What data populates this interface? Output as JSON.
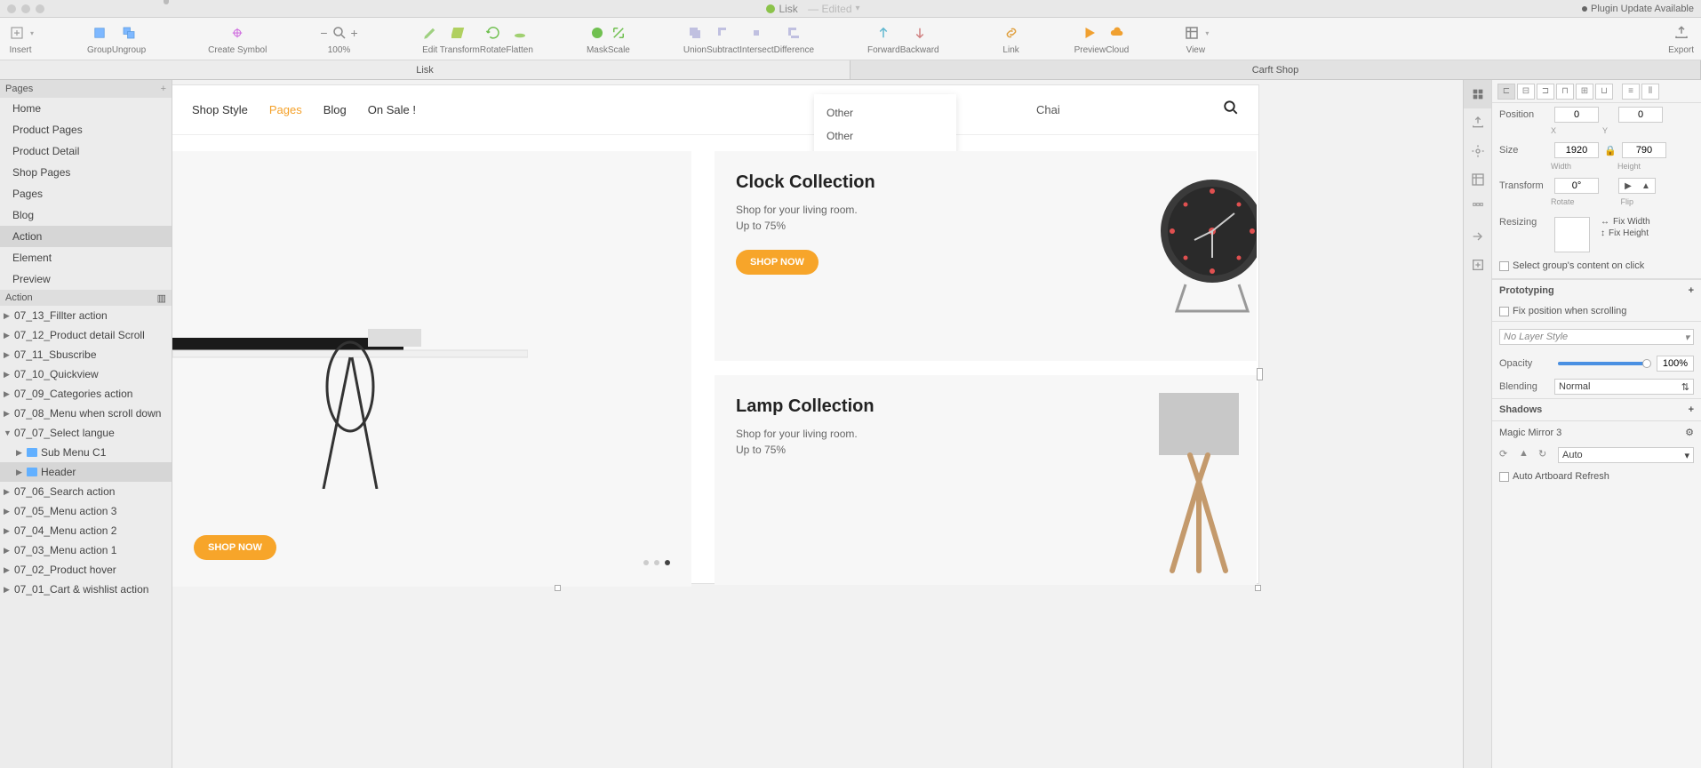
{
  "titlebar": {
    "doc": "Lisk",
    "status": "— Edited",
    "plugin": "Plugin Update Available"
  },
  "toolbar": {
    "insert": "Insert",
    "group": "Group",
    "ungroup": "Ungroup",
    "create_symbol": "Create Symbol",
    "zoom": "100%",
    "edit": "Edit",
    "transform": "Transform",
    "rotate": "Rotate",
    "flatten": "Flatten",
    "mask": "Mask",
    "scale": "Scale",
    "union": "Union",
    "subtract": "Subtract",
    "intersect": "Intersect",
    "difference": "Difference",
    "forward": "Forward",
    "backward": "Backward",
    "link": "Link",
    "preview": "Preview",
    "cloud": "Cloud",
    "view": "View",
    "export": "Export"
  },
  "doc_tabs": {
    "tab1": "Lisk",
    "tab2": "Carft Shop"
  },
  "pages": {
    "header": "Pages",
    "items": [
      "Home",
      "Product Pages",
      "Product Detail",
      "Shop Pages",
      "Pages",
      "Blog",
      "Action",
      "Element",
      "Preview"
    ]
  },
  "layers": {
    "header": "Action",
    "items": [
      "07_13_Fillter action",
      "07_12_Product detail Scroll",
      "07_11_Sbuscribe",
      "07_10_Quickview",
      "07_09_Categories action",
      "07_08_Menu when scroll down",
      "07_07_Select langue",
      "Sub Menu C1",
      "Header",
      "07_06_Search action",
      "07_05_Menu action 3",
      "07_04_Menu action 2",
      "07_03_Menu action 1",
      "07_02_Product hover",
      "07_01_Cart & wishlist action"
    ]
  },
  "canvas": {
    "nav": {
      "shop_style": "Shop Style",
      "pages": "Pages",
      "blog": "Blog",
      "onsale": "On Sale !"
    },
    "search_value": "Chai",
    "dropdown": {
      "opt1": "Other",
      "opt2": "Other"
    },
    "card1": {
      "title": "Clock Collection",
      "line1": "Shop for your living room.",
      "line2": "Up to 75%",
      "btn": "SHOP NOW"
    },
    "card2": {
      "title": "Lamp Collection",
      "line1": "Shop for your living room.",
      "line2": "Up to 75%"
    },
    "left_btn": "SHOP NOW"
  },
  "inspector": {
    "position_label": "Position",
    "pos_x": "0",
    "pos_y": "0",
    "x_label": "X",
    "y_label": "Y",
    "size_label": "Size",
    "width": "1920",
    "height": "790",
    "w_label": "Width",
    "h_label": "Height",
    "transform_label": "Transform",
    "rotate": "0°",
    "rotate_label": "Rotate",
    "flip_label": "Flip",
    "resizing_label": "Resizing",
    "fix_width": "Fix Width",
    "fix_height": "Fix Height",
    "select_group": "Select group's content on click",
    "prototyping": "Prototyping",
    "fix_scroll": "Fix position when scrolling",
    "layer_style": "No Layer Style",
    "opacity_label": "Opacity",
    "opacity_val": "100%",
    "blending_label": "Blending",
    "blending_val": "Normal",
    "shadows": "Shadows",
    "mm3": "Magic Mirror 3",
    "mm_auto": "Auto",
    "auto_refresh": "Auto Artboard Refresh"
  }
}
